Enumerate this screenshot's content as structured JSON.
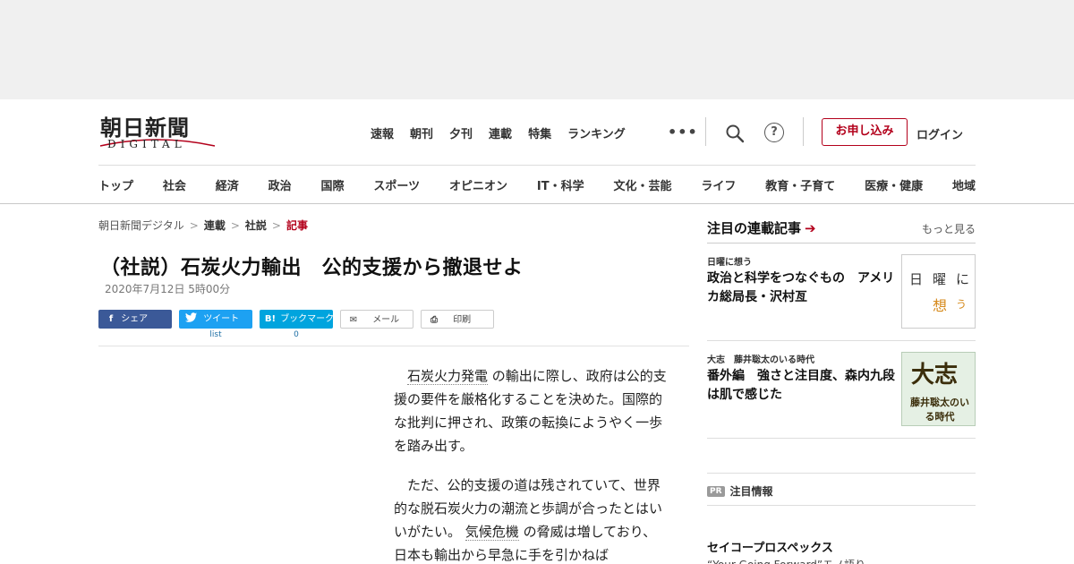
{
  "header": {
    "logo_main": "朝日新聞",
    "logo_sub": "DIGITAL",
    "top_nav": [
      "速報",
      "朝刊",
      "夕刊",
      "連載",
      "特集",
      "ランキング"
    ],
    "more_label": "•••",
    "apply_label": "お申し込み",
    "login_label": "ログイン",
    "help_label": "?",
    "categories": [
      "トップ",
      "社会",
      "経済",
      "政治",
      "国際",
      "スポーツ",
      "オピニオン",
      "IT・科学",
      "文化・芸能",
      "ライフ",
      "教育・子育て",
      "医療・健康",
      "地域"
    ]
  },
  "breadcrumb": {
    "items": [
      "朝日新聞デジタル",
      "連載",
      "社説"
    ],
    "current": "記事",
    "sep": ">"
  },
  "article": {
    "title": "（社説）石炭火力輸出　公的支援から撤退せよ",
    "date": "2020年7月12日 5時00分",
    "share": {
      "facebook": "シェア",
      "twitter": "ツイート",
      "twitter_count": "list",
      "hatena": "ブックマーク",
      "hatena_count": "0",
      "mail": "メール",
      "print": "印刷"
    },
    "paragraph1": {
      "kw": "石炭火力発電",
      "rest": "の輸出に際し、政府は公的支援の要件を厳格化することを決めた。国際的な批判に押され、政策の転換にようやく一歩を踏み出す。"
    },
    "paragraph2": {
      "before": "ただ、公的支援の道は残されていて、世界的な脱石炭火力の潮流と歩調が合ったとはいいがたい。",
      "kw": "気候危機",
      "after": "の脅威は増しており、日本も輸出から早急に手を引かねば"
    }
  },
  "sidebar": {
    "heading": "注目の連載記事",
    "arrow": "➔",
    "more": "もっと見る",
    "items": [
      {
        "label": "日曜に想う",
        "title": "政治と科学をつなぐもの　アメリカ総局長・沢村亙",
        "thumb_a": "日曜に",
        "thumb_b": "想",
        "thumb_c": "う"
      },
      {
        "label": "大志　藤井聡太のいる時代",
        "title": "番外編　強さと注目度、森内九段は肌で感じた",
        "thumb_a": "大志",
        "thumb_b": "藤井聡太のいる時代"
      }
    ],
    "pr_badge": "PR",
    "pr_label": "注目情報",
    "sponsor_title": "セイコープロスペックス",
    "sponsor_sub": "“Your Going Forward”モノ語り"
  }
}
